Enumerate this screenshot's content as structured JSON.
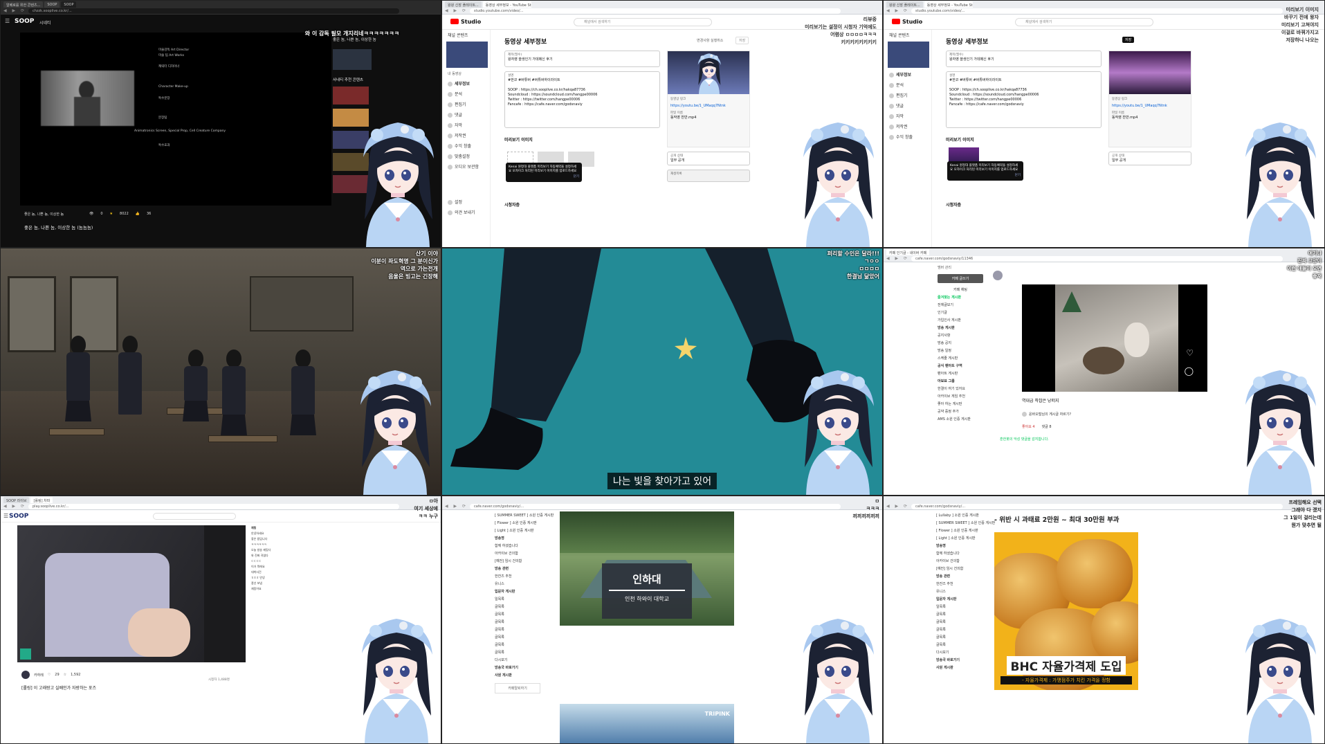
{
  "panels": {
    "p1": {
      "tabs": [
        "알베로를 위한 콘텐츠...",
        "SOOP",
        "SOOP"
      ],
      "address": "chzzk.sooplive.co.kr/...",
      "brand": "SOOP",
      "brand_sub": "시네티",
      "overlay": "와 이 감독 필모 개지리네ㅋㅋㅋㅋㅋㅋㅋ",
      "overlay_top": "ㄷ",
      "credits": [
        "미술감독 Art Director",
        "미술 팀 Art Works",
        "캐릭터 디자이너",
        "Character Make-up",
        "특수분장",
        "Animatronics Screen, Special Prop, Cell Creature Company",
        "분장팀",
        "특수효과"
      ],
      "video_title": "좋은 놈, 나쁜 놈, 이상한 놈 (놈놈놈)",
      "meta": "좋은 놈, 나쁜 놈, 이상한 놈",
      "stats": [
        "0",
        "8022",
        "36"
      ],
      "side_title": "좋은 놈, 나쁜 놈, 이상한 놈",
      "side_heading": "사네티 추천 콘텐츠"
    },
    "p2": {
      "tabs": [
        "왕왕 신장 플레이트...",
        "동영상 세부정보 - YouTube Studio"
      ],
      "address": "studio.youtube.com/video/...",
      "brand": "Studio",
      "search": "채널에서 검색하기",
      "title": "동영상 세부정보",
      "buttons": [
        "변경사항 실행취소",
        "저장"
      ],
      "sidebar": [
        "채널 콘텐츠",
        "세부정보",
        "분석",
        "편집기",
        "댓글",
        "자막",
        "저작권",
        "수익 창출",
        "맞춤설정",
        "오디오 보관함",
        "설정",
        "의견 보내기"
      ],
      "channel_label": "내 동영상",
      "title_field_label": "제목(필수)",
      "title_field_value": "왕자영 쓸생인기 가데메신 후기",
      "desc_field_label": "설명",
      "desc_field_value": "#한코 #버튜버 #버튜버하이라이트\n\nSOOP : https://ch.sooplive.co.kr/hakqa87736\nSoundcloud : https://soundcloud.com/hangpe00006\nTwitter : https://twitter.com/hangpe00006\nFancafe : https://cafe.naver.com/godsnaviy",
      "video_link_label": "동영상 링크",
      "video_link": "https://youtu.be/1_UMaqq7Ntnk",
      "filename_label": "파일 이름",
      "filename": "동작영 찬반.mp4",
      "visibility_label": "공개 상태",
      "visibility": "일부 공개",
      "thumb_label": "미리보기 이미지",
      "playlist_label": "재생목록",
      "audience_label": "시청자층",
      "popup": "Kenai 원정대 플랫폼 미리보기 자동예약을 설정하세요 모자이크 처리된 미리보기 이미지를 업로드하세요",
      "popup_btn": "닫기",
      "overlay": "리뷰중\n미리보기는 설정이 시청자 기억에도\n어렴상 ㅁㅁㅁㅁㅋㅋㅋ\n키키키키키키키키"
    },
    "p3": {
      "tabs": [
        "왕왕 신장 플레이트...",
        "동영상 세부정보 - YouTube Studio"
      ],
      "address": "studio.youtube.com/video/...",
      "brand": "Studio",
      "search": "채널에서 검색하기",
      "title": "동영상 세부정보",
      "title_field_value": "왕자영 쓸생인기 가데메신 후기",
      "overlay": "미리보기 이미지\n바꾸기 전에 왕자\n미리보기 고쳐야지\n이걸로 바꿔가지고\n저장하니 나오는"
    },
    "p4": {
      "overlay": "산기 이야\n이분이 좌도혁명 그 분이신가\n역으로 가는전개\n음울은 빙고는 긴장해"
    },
    "p5": {
      "overlay": "퍼리할 수인은 달라!!!\nㄱㅇㅇ\nㅁㅁㅁㅁ\n한결님 닮았어",
      "subtitle": "나는 빛을 찾아가고 있어"
    },
    "p6": {
      "tabs": [
        "카페 인기글 - 네이버 카페"
      ],
      "address": "cafe.naver.com/godsnaviy/11346",
      "overlay": "애기냐\n진짜 고양이\n이런 애들이 오면\n좋재",
      "side_items": [
        "멤버 관리",
        "카페 글쓰기",
        "카페 채팅",
        "즐겨찾는 게시판",
        "전체글보기",
        "인기글",
        "가입인사 게시판",
        "방송 게시판",
        "공지사항",
        "방송 공지",
        "방송 일정",
        "스케줄 게시판",
        "공식 팬아트 구역",
        "팬아트 게시판",
        "아뵤뵤 그룹",
        "한결이 여기 있어요",
        "아카이브 게임 추천",
        "좋아 하는 게시판",
        "공약 증정 추가",
        "AMS 소원 인증 게시판"
      ],
      "caption": "역대급 착찹은 낭떠지",
      "comment_author": "윤바오털님의 게시글 자르기?",
      "bottom": "훈한봇의 악성 댓글을 감지합니다.",
      "stats": [
        "좋아요 4",
        "댓글 8"
      ]
    },
    "p7": {
      "tabs": [
        "SOOP 라이브",
        "[롤링] 차파"
      ],
      "address": "play.sooplive.co.kr/...",
      "brand": "SOOP",
      "overlay": "ㅁ아\n여기 세상에\nㅋㅋ 누구",
      "chat_title": "채팅",
      "chat": [
        "안녕하세요",
        "좋은 밤입니다",
        "ㅋㅋㅋㅋㅋㅋ",
        "오늘 방송 재밌다",
        "와 진짜 귀엽다",
        "ㄷㄷㄷㄷ",
        "이거 뭐에요",
        "대박사건",
        "ㅎㅎㅎ 안녕",
        "풍선 보냄",
        "재밌어요"
      ],
      "stream_caption": "[롤링] 이 고래랑고 실배인가 자랑하는 포즈",
      "streamer": "카하레",
      "stats": [
        "29",
        "1,592"
      ],
      "viewers": "시청자 1,488명"
    },
    "p8": {
      "address": "cafe.naver.com/godsnaviy/...",
      "side_items": [
        "[ SUMMER SWEET ] 소원 인증 게시판",
        "[ Flower ] 소원 인증 게시판",
        "[ Light ] 소원 인증 게시판",
        "방송명",
        "함께 하셨습니다",
        "아카이브 건의함",
        "[예전] 임시 건의함",
        "방송 관련",
        "한잔즈 추천",
        "유니스",
        "입문자 게시판",
        "일목록",
        "글목록",
        "글목록",
        "글목록",
        "글목록",
        "글목록",
        "글목록",
        "글목록",
        "다시보기",
        "방송국 바로가기",
        "사원 게시판"
      ],
      "sign_title": "인하대",
      "sign_sub": "인천 하와이 대학교",
      "overlay": "ㅁ\nㅋㅋㅋ\n끼끼끼끼끼끼",
      "footer_button": "카페탈퇴하기",
      "brand": "TRIPINK"
    },
    "p9": {
      "address": "cafe.naver.com/godsnaviy/...",
      "headline": "- 위반 시 과태료 2만원 ~ 최대 30만원 부과",
      "ad_title": "BHC 자율가격제 도입",
      "ad_sub": "- 자율가격제 : 가맹점주가 치킨 가격을 정함",
      "side_items": [
        "[ Lullaby ] 소원 인증 게시판",
        "[ SUMMER SWEET ] 소원 인증 게시판",
        "[ Flower ] 소원 인증 게시판",
        "[ Light ] 소원 인증 게시판",
        "방송명",
        "함께 하셨습니다",
        "아카이브 건의함",
        "[예전] 임시 건의함",
        "방송 관련",
        "한잔즈 추천",
        "유니스",
        "입문자 게시판",
        "일목록",
        "글목록",
        "글목록",
        "글목록",
        "글목록",
        "글목록",
        "다시보기",
        "방송국 바로가기",
        "사원 게시판"
      ],
      "overlay": "프레임해요 선택\n그래야 다 겠지\n그 1일이 걸리는데\n뭔가 맞추면 될"
    }
  },
  "colors": {
    "youtube_red": "#ff0000",
    "soop_blue": "#1a2b6d",
    "teal": "#238b96",
    "naver_green": "#03c75a",
    "chicken_yellow": "#f2b21a"
  }
}
